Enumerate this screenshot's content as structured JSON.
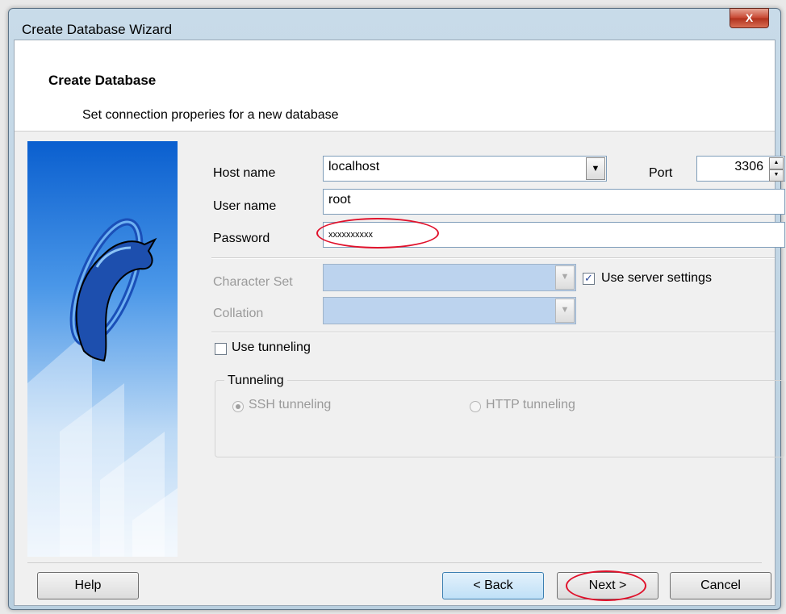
{
  "window": {
    "title": "Create Database Wizard",
    "close_glyph": "X"
  },
  "header": {
    "title": "Create Database",
    "subtitle": "Set connection properies for a new database"
  },
  "connection": {
    "host_label": "Host name",
    "host_value": "localhost",
    "port_label": "Port",
    "port_value": "3306",
    "user_label": "User name",
    "user_value": "root",
    "password_label": "Password",
    "password_value": "xxxxxxxxxx"
  },
  "charset": {
    "charset_label": "Character Set",
    "collation_label": "Collation",
    "use_server_settings_label": "Use server settings",
    "use_server_settings_checked": true
  },
  "tunneling": {
    "use_tunneling_label": "Use tunneling",
    "use_tunneling_checked": false,
    "group_title": "Tunneling",
    "ssh_label": "SSH tunneling",
    "http_label": "HTTP tunneling",
    "selected": "ssh"
  },
  "buttons": {
    "help": "Help",
    "back": "< Back",
    "next": "Next >",
    "cancel": "Cancel"
  },
  "colors": {
    "annotation": "#e0112b",
    "accent": "#0a5fcf"
  },
  "icons": {
    "logo": "dolphin-logo-icon",
    "close": "close-icon",
    "dropdown": "chevron-down-icon",
    "spin": "spin-arrows-icon"
  }
}
